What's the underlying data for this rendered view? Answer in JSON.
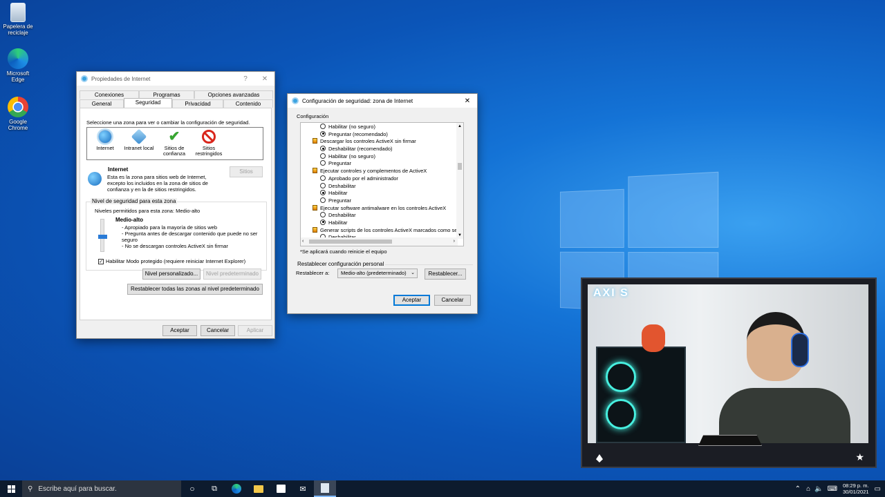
{
  "desktop": {
    "icons": [
      {
        "label": "Papelera de reciclaje"
      },
      {
        "label": "Microsoft Edge"
      },
      {
        "label": "Google Chrome"
      }
    ]
  },
  "internet_props": {
    "title": "Propiedades de Internet",
    "help": "?",
    "close": "✕",
    "tabs_row1": [
      "Conexiones",
      "Programas",
      "Opciones avanzadas"
    ],
    "tabs_row2": [
      "General",
      "Seguridad",
      "Privacidad",
      "Contenido"
    ],
    "select_zone_text": "Seleccione una zona para ver o cambiar la configuración de seguridad.",
    "zones": [
      {
        "label": "Internet",
        "icon": "globe-icon"
      },
      {
        "label": "Intranet local",
        "icon": "network-icon"
      },
      {
        "label": "Sitios de confianza",
        "icon": "checkmark-icon"
      },
      {
        "label": "Sitios restringidos",
        "icon": "blocked-icon"
      }
    ],
    "zone_heading": "Internet",
    "zone_description": "Esta es la zona para sitios web de Internet, excepto los incluidos en la zona de sitios de confianza y en la de sitios restringidos.",
    "sites_button": "Sitios",
    "security_level_legend": "Nivel de seguridad para esta zona",
    "allowed_levels": "Niveles permitidos para esta zona: Medio-alto",
    "level_name": "Medio-alto",
    "level_bullets": [
      "- Apropiado para la mayoría de sitios web",
      "- Pregunta antes de descargar contenido que puede no ser seguro",
      "- No se descargan controles ActiveX sin firmar"
    ],
    "protected_mode": "Habilitar Modo protegido (requiere reiniciar Internet Explorer)",
    "custom_level_button": "Nivel personalizado...",
    "default_level_button": "Nivel predeterminado",
    "reset_all_button": "Restablecer todas las zonas al nivel predeterminado",
    "ok": "Aceptar",
    "cancel": "Cancelar",
    "apply": "Aplicar"
  },
  "security_settings": {
    "title": "Configuración de seguridad: zona de Internet",
    "close": "✕",
    "config_label": "Configuración",
    "items": [
      {
        "kind": "radio",
        "checked": false,
        "text": "Habilitar (no seguro)"
      },
      {
        "kind": "radio",
        "checked": true,
        "text": "Preguntar (recomendado)"
      },
      {
        "kind": "header",
        "text": "Descargar los controles ActiveX sin firmar"
      },
      {
        "kind": "radio",
        "checked": true,
        "text": "Deshabilitar (recomendado)"
      },
      {
        "kind": "radio",
        "checked": false,
        "text": "Habilitar (no seguro)"
      },
      {
        "kind": "radio",
        "checked": false,
        "text": "Preguntar"
      },
      {
        "kind": "header",
        "text": "Ejecutar controles y complementos de ActiveX"
      },
      {
        "kind": "radio",
        "checked": false,
        "text": "Aprobado por el administrador"
      },
      {
        "kind": "radio",
        "checked": false,
        "text": "Deshabilitar"
      },
      {
        "kind": "radio",
        "checked": true,
        "text": "Habilitar"
      },
      {
        "kind": "radio",
        "checked": false,
        "text": "Preguntar"
      },
      {
        "kind": "header",
        "text": "Ejecutar software antimalware en los controles ActiveX"
      },
      {
        "kind": "radio",
        "checked": false,
        "text": "Deshabilitar"
      },
      {
        "kind": "radio",
        "checked": true,
        "text": "Habilitar"
      },
      {
        "kind": "header",
        "text": "Generar scripts de los controles ActiveX marcados como segu"
      },
      {
        "kind": "radio",
        "checked": false,
        "text": "Deshabilitar"
      }
    ],
    "restart_note": "*Se aplicará cuando reinicie el equipo",
    "reset_legend": "Restablecer configuración personal",
    "reset_to_label": "Restablecer a:",
    "reset_to_value": "Medio-alto (predeterminado)",
    "reset_button": "Restablecer...",
    "ok": "Aceptar",
    "cancel": "Cancelar"
  },
  "webcam": {
    "brand": "AXI S"
  },
  "taskbar": {
    "search_placeholder": "Escribe aquí para buscar.",
    "time": "08:29 p. m.",
    "date": "30/01/2021"
  }
}
